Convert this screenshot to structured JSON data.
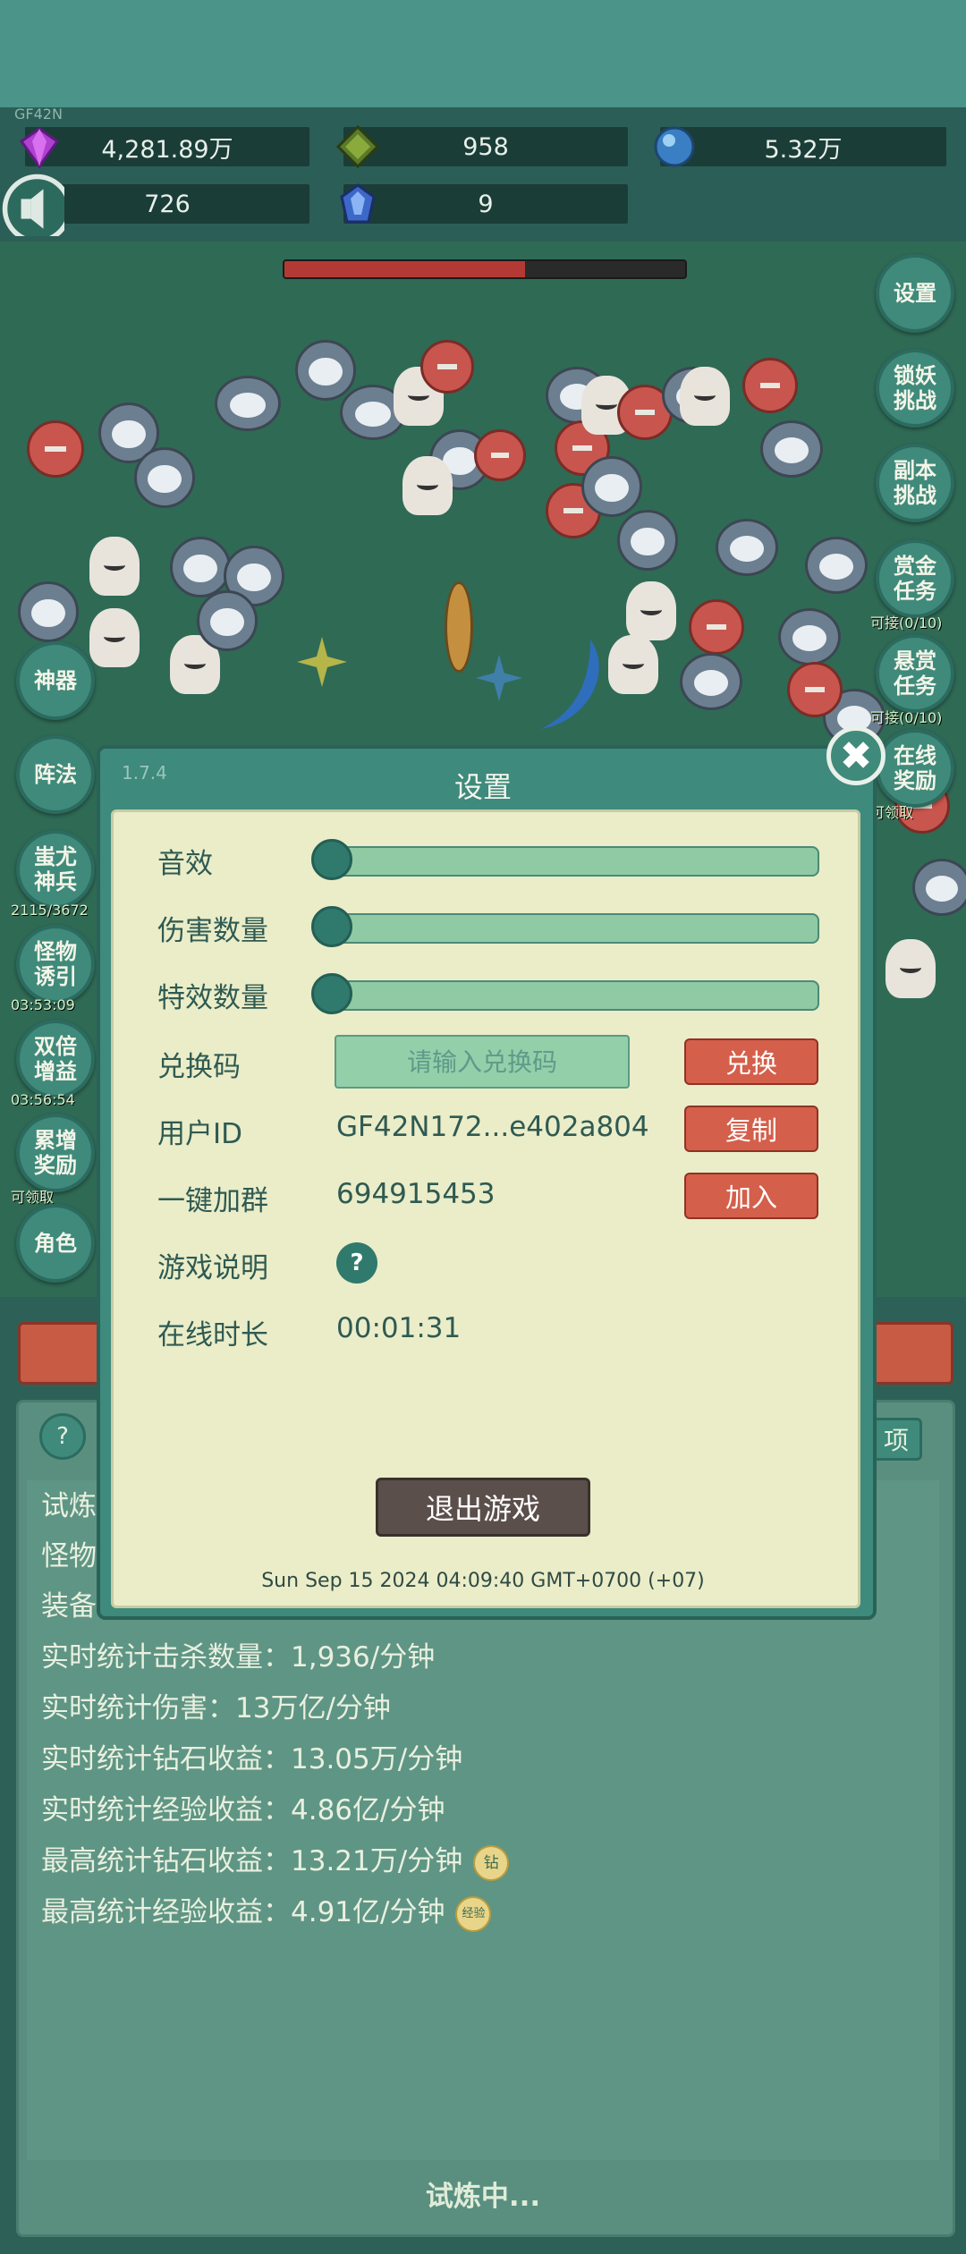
{
  "game_tag": "GF42N",
  "resources": {
    "diamonds": "4,281.89万",
    "gems": "958",
    "orbs": "5.32万",
    "row2_value": "726",
    "crystals": "9"
  },
  "boss_hp_fraction": 0.6,
  "right_menu": [
    {
      "label": "设置",
      "sub": ""
    },
    {
      "label": "锁妖\n挑战",
      "sub": ""
    },
    {
      "label": "副本\n挑战",
      "sub": ""
    },
    {
      "label": "赏金\n任务",
      "sub": "可接(0/10)"
    },
    {
      "label": "悬赏\n任务",
      "sub": "可接(0/10)"
    },
    {
      "label": "在线\n奖励",
      "sub": "可领取"
    }
  ],
  "left_menu": [
    {
      "label": "神器",
      "sub": ""
    },
    {
      "label": "阵法",
      "sub": ""
    },
    {
      "label": "蚩尤\n神兵",
      "sub": "2115/3672"
    },
    {
      "label": "怪物\n诱引",
      "sub": "03:53:09"
    },
    {
      "label": "双倍\n增益",
      "sub": "03:56:54"
    },
    {
      "label": "累增\n奖励",
      "sub": "可领取"
    },
    {
      "label": "角色",
      "sub": ""
    }
  ],
  "settings": {
    "version": "1.7.4",
    "title": "设置",
    "sound_label": "音效",
    "sound_level": 0,
    "damage_count_label": "伤害数量",
    "damage_count_level": 0,
    "effects_count_label": "特效数量",
    "effects_count_level": 0,
    "redeem_label": "兑换码",
    "redeem_placeholder": "请输入兑换码",
    "redeem_button": "兑换",
    "user_id_label": "用户ID",
    "user_id": "GF42N172...e402a804",
    "copy_button": "复制",
    "group_label": "一键加群",
    "group_number": "694915453",
    "join_button": "加入",
    "instructions_label": "游戏说明",
    "help_glyph": "?",
    "online_time_label": "在线时长",
    "online_time": "00:01:31",
    "exit_button": "退出游戏",
    "close_glyph": "✖",
    "timestamp": "Sun Sep 15 2024 04:09:40 GMT+0700 (+07)"
  },
  "stats": {
    "help_glyph": "?",
    "right_button_partial": "项",
    "partial_lines": [
      "试炼",
      "怪物",
      "装备"
    ],
    "lines": [
      "实时统计击杀数量：1,936/分钟",
      "实时统计伤害：13万亿/分钟",
      "实时统计钻石收益：13.05万/分钟",
      "实时统计经验收益：4.86亿/分钟",
      "最高统计钻石收益：13.21万/分钟",
      "最高统计经验收益：4.91亿/分钟"
    ],
    "diamond_chip": "钻",
    "exp_chip": "经验",
    "status": "试炼中..."
  },
  "colors": {
    "accent_teal": "#3e8a7c",
    "button_red": "#d45f4b",
    "panel_cream": "#eaedc8"
  }
}
